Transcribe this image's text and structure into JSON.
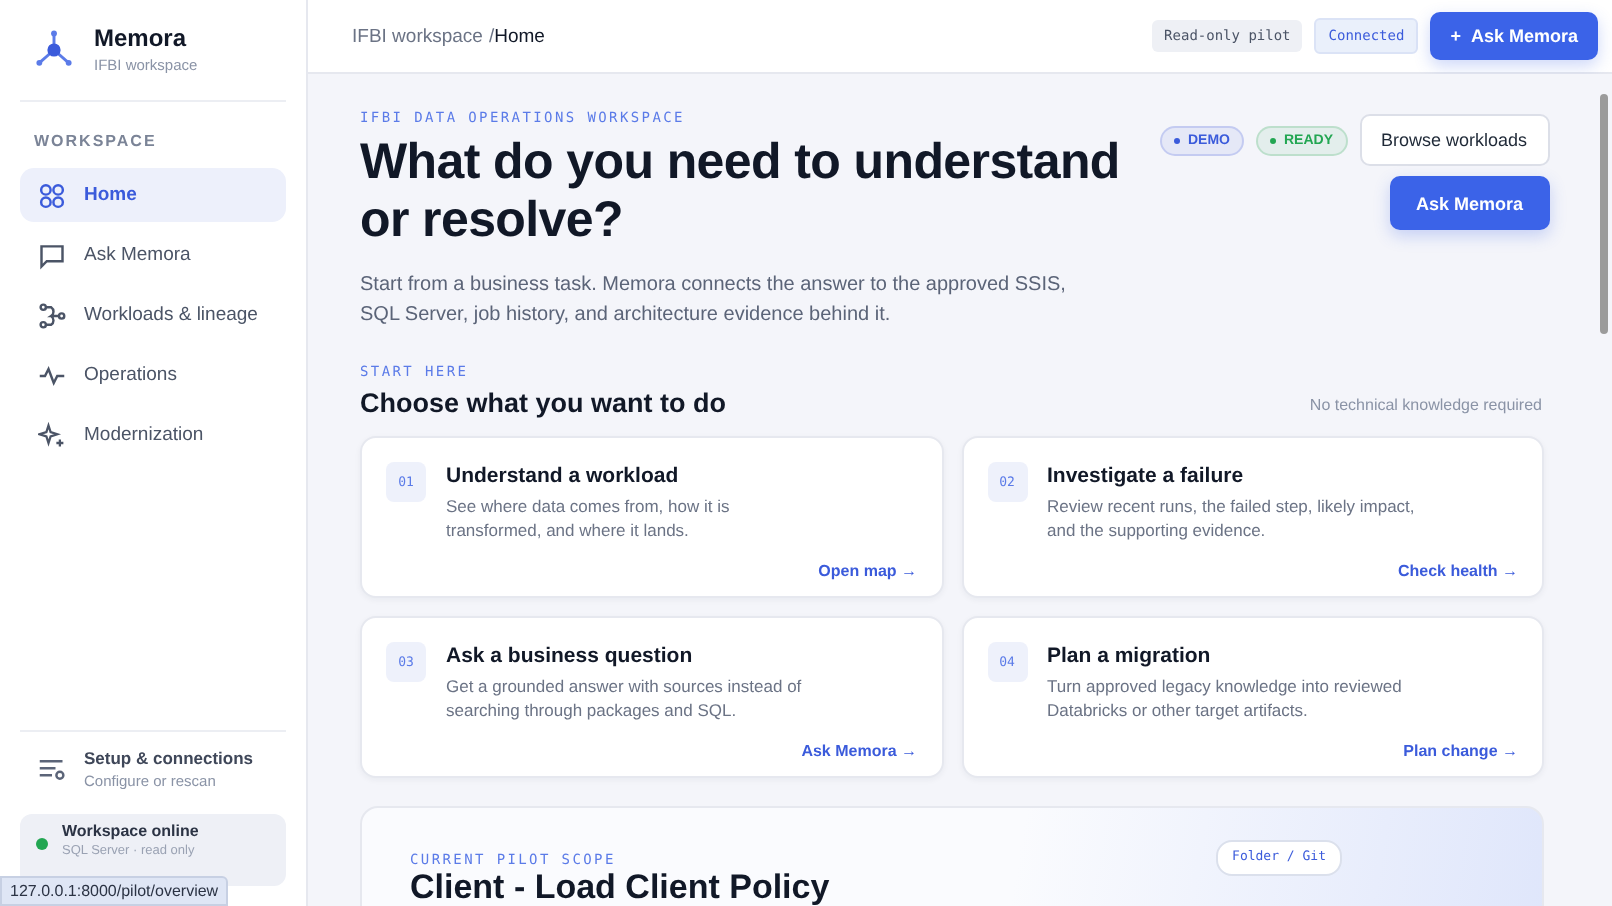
{
  "brand": {
    "name": "Memora",
    "subtitle": "IFBI workspace"
  },
  "sidebar": {
    "section": "WORKSPACE",
    "items": [
      {
        "label": "Home",
        "selected": true
      },
      {
        "label": "Ask Memora",
        "selected": false
      },
      {
        "label": "Workloads & lineage",
        "selected": false
      },
      {
        "label": "Operations",
        "selected": false
      },
      {
        "label": "Modernization",
        "selected": false
      }
    ],
    "setup": {
      "title": "Setup & connections",
      "subtitle": "Configure or rescan"
    },
    "status": {
      "title": "Workspace online",
      "subtitle": "SQL Server · read only",
      "color": "#22a652"
    }
  },
  "topbar": {
    "breadcrumb": [
      "IFBI workspace",
      "Home"
    ],
    "separator": "/",
    "badges": [
      "Read-only pilot",
      "Connected"
    ],
    "button": "Ask Memora",
    "button_icon": "+"
  },
  "hero": {
    "eyebrow": "IFBI DATA OPERATIONS WORKSPACE",
    "title": "What do you need to understand or resolve?",
    "text": "Start from a business task. Memora connects the answer to the approved SSIS, SQL Server, job history, and architecture evidence behind it.",
    "pills": [
      {
        "label": "DEMO",
        "color": "#3b5bdb"
      },
      {
        "label": "READY",
        "color": "#22a652"
      }
    ],
    "secondary_button": "Browse workloads",
    "primary_button": "Ask Memora"
  },
  "tasks": {
    "eyebrow": "START HERE",
    "title": "Choose what you want to do",
    "note": "No technical knowledge required",
    "cards": [
      {
        "number": "01",
        "title": "Understand a workload",
        "text": "See where data comes from, how it is transformed, and where it lands.",
        "link": "Open map →"
      },
      {
        "number": "02",
        "title": "Investigate a failure",
        "text": "Review recent runs, the failed step, likely impact, and the supporting evidence.",
        "link": "Check health →"
      },
      {
        "number": "03",
        "title": "Ask a business question",
        "text": "Get a grounded answer with sources instead of searching through packages and SQL.",
        "link": "Ask Memora →"
      },
      {
        "number": "04",
        "title": "Plan a migration",
        "text": "Turn approved legacy knowledge into reviewed Databricks or other target artifacts.",
        "link": "Plan change →"
      }
    ]
  },
  "scope": {
    "eyebrow": "CURRENT PILOT SCOPE",
    "title": "Client - Load Client Policy",
    "chip": "Folder / Git"
  },
  "status_bar": "127.0.0.1:8000/pilot/overview"
}
